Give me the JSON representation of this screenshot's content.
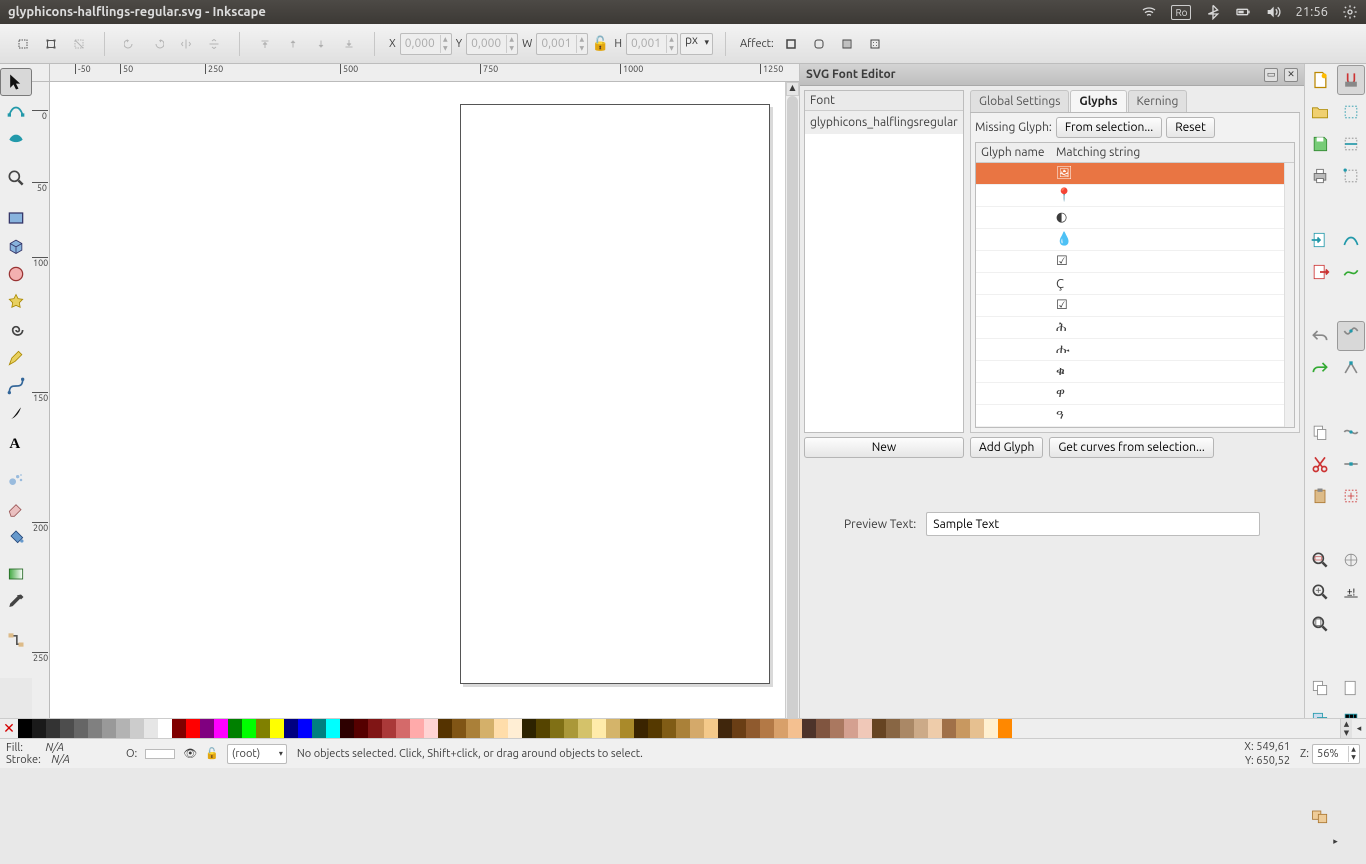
{
  "window_title": "glyphicons-halflings-regular.svg - Inkscape",
  "sysbar": {
    "keyboard": "Ro",
    "time": "21:56"
  },
  "toolbar": {
    "X": "0,000",
    "Y": "0,000",
    "W": "0,001",
    "H": "0,001",
    "unit": "px",
    "affect_label": "Affect:"
  },
  "ruler_h": [
    "-50",
    "50",
    "250",
    "500",
    "750",
    "1000",
    "1250"
  ],
  "ruler_v": [
    "0",
    "50",
    "100",
    "150",
    "200",
    "250"
  ],
  "fonteditor": {
    "title": "SVG Font Editor",
    "font_header": "Font",
    "font_item": "glyphicons_halflingsregular",
    "tabs": {
      "global": "Global Settings",
      "glyphs": "Glyphs",
      "kerning": "Kerning"
    },
    "missing_glyph_label": "Missing Glyph:",
    "from_selection_btn": "From selection...",
    "reset_btn": "Reset",
    "grid_headers": {
      "name": "Glyph name",
      "match": "Matching string"
    },
    "glyph_rows": [
      {
        "name": "",
        "match": "🖼",
        "sel": true
      },
      {
        "name": "",
        "match": "📍"
      },
      {
        "name": "",
        "match": "◐"
      },
      {
        "name": "",
        "match": "💧"
      },
      {
        "name": "",
        "match": "☑"
      },
      {
        "name": "",
        "match": "Ç"
      },
      {
        "name": "",
        "match": "☑"
      },
      {
        "name": "",
        "match": "ሕ"
      },
      {
        "name": "",
        "match": "ሑ"
      },
      {
        "name": "",
        "match": "ቁ"
      },
      {
        "name": "",
        "match": "ዋ"
      },
      {
        "name": "",
        "match": "ዓ"
      }
    ],
    "new_btn": "New",
    "add_glyph_btn": "Add Glyph",
    "get_curves_btn": "Get curves from selection...",
    "preview_label": "Preview Text:",
    "preview_value": "Sample Text"
  },
  "palette_colors": [
    "#000000",
    "#1a1a1a",
    "#333333",
    "#4d4d4d",
    "#666666",
    "#808080",
    "#999999",
    "#b3b3b3",
    "#cccccc",
    "#e6e6e6",
    "#ffffff",
    "#800000",
    "#ff0000",
    "#800080",
    "#ff00ff",
    "#008000",
    "#00ff00",
    "#808000",
    "#ffff00",
    "#000080",
    "#0000ff",
    "#008080",
    "#00ffff",
    "#2d0000",
    "#550000",
    "#801515",
    "#aa3939",
    "#d46a6a",
    "#ffaaaa",
    "#ffd4d4",
    "#553300",
    "#805515",
    "#aa8039",
    "#d4b06a",
    "#ffddaa",
    "#ffeed4",
    "#2d2300",
    "#554400",
    "#807015",
    "#aa9839",
    "#d4c26a",
    "#ffebaa",
    "#d4b46a",
    "#aa8a2a",
    "#3a2400",
    "#553900",
    "#805c15",
    "#aa8139",
    "#d4a96a",
    "#f4c98a",
    "#40260c",
    "#6a3e15",
    "#8f5a2e",
    "#b37946",
    "#d8a06a",
    "#f4c090",
    "#4d332a",
    "#805540",
    "#aa7860",
    "#d4a090",
    "#f0c8b8",
    "#664422",
    "#886644",
    "#aa8866",
    "#ccaa88",
    "#eeccaa",
    "#a07048",
    "#c89860",
    "#e6c090",
    "#fff0d0",
    "#ff8800"
  ],
  "status": {
    "fill_label": "Fill:",
    "fill_value": "N/A",
    "stroke_label": "Stroke:",
    "stroke_value": "N/A",
    "opacity_label": "O:",
    "layer": "(root)",
    "message": "No objects selected. Click, Shift+click, or drag around objects to select.",
    "X_label": "X:",
    "X": "549,61",
    "Y_label": "Y:",
    "Y": "650,52",
    "Z_label": "Z:",
    "Z": "56%"
  }
}
